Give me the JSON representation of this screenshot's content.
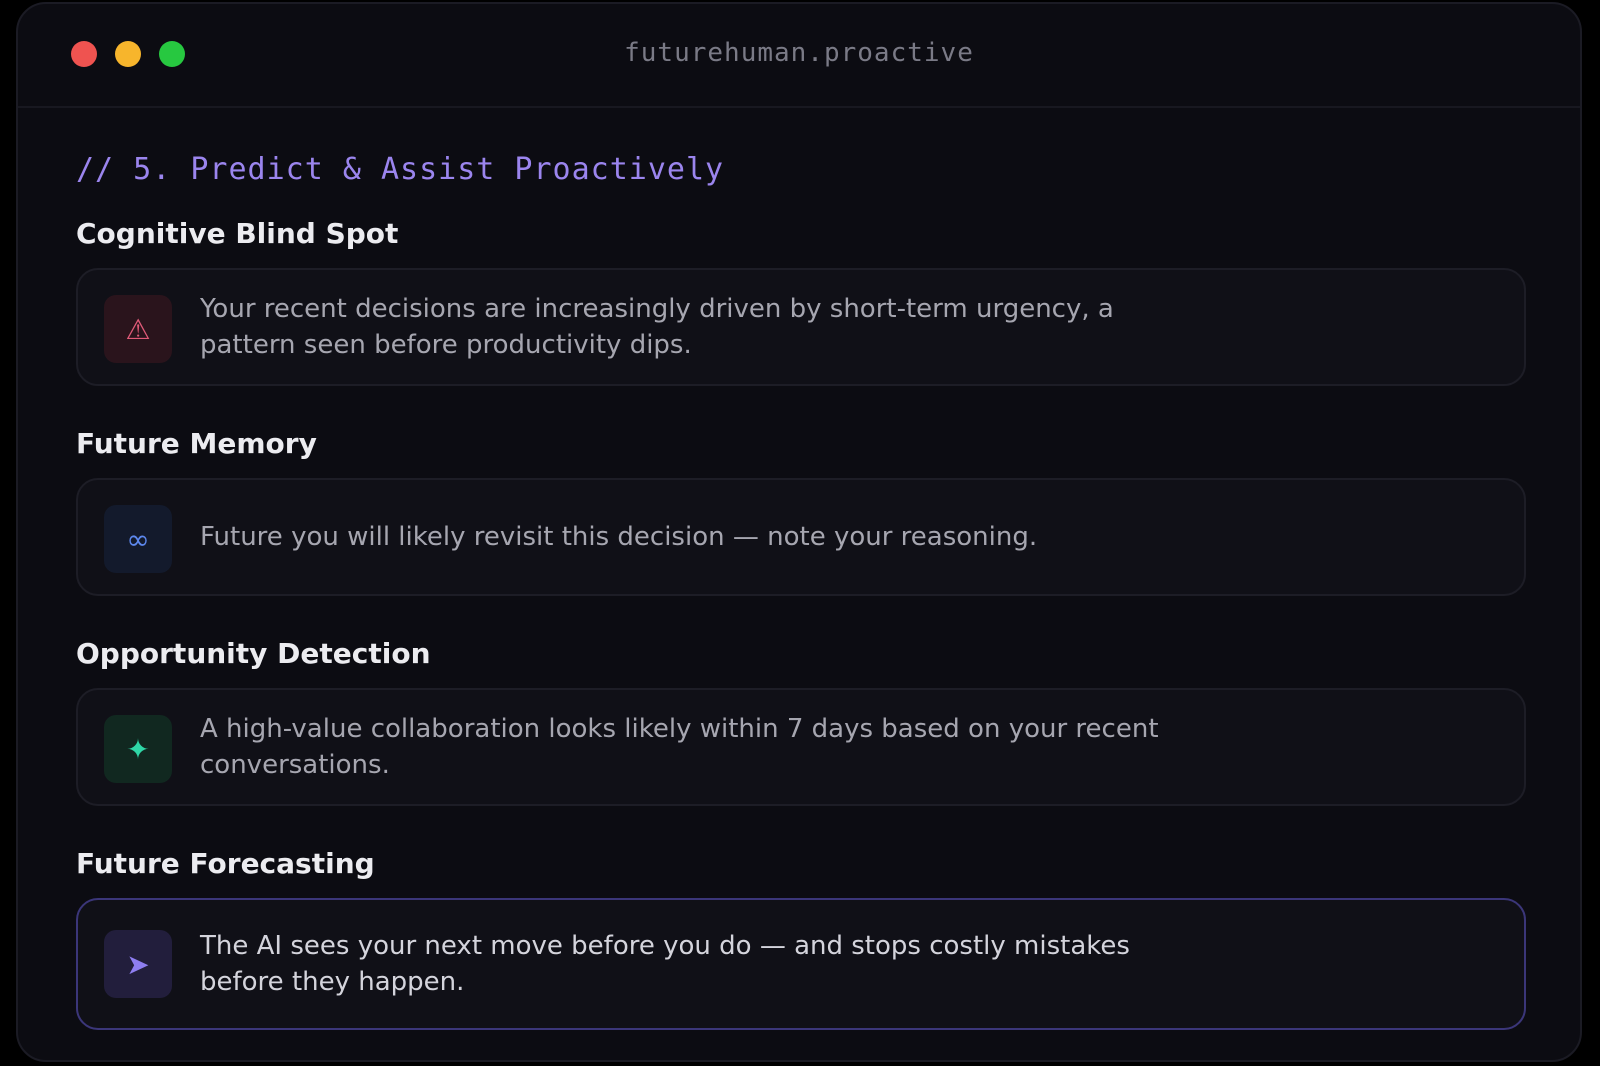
{
  "window": {
    "title": "futurehuman.proactive",
    "controls": {
      "close_color": "#ef5350",
      "minimize_color": "#f7b52c",
      "maximize_color": "#27c840"
    }
  },
  "section": {
    "comment": "// 5. Predict & Assist Proactively"
  },
  "cards": [
    {
      "heading": "Cognitive Blind Spot",
      "icon": "warning-icon",
      "glyph": "⚠",
      "text": "Your recent decisions are increasingly driven by short-term urgency, a pattern seen before productivity dips."
    },
    {
      "heading": "Future Memory",
      "icon": "infinity-icon",
      "glyph": "∞",
      "text": "Future you will likely revisit this decision — note your reasoning."
    },
    {
      "heading": "Opportunity Detection",
      "icon": "sparkle-icon",
      "glyph": "✦",
      "text": "A high-value collaboration looks likely within 7 days based on your recent conversations."
    },
    {
      "heading": "Future Forecasting",
      "icon": "arrow-icon",
      "glyph": "➤",
      "text": "The AI sees your next move before you do — and stops costly mistakes before they happen."
    }
  ],
  "colors": {
    "accent": "#9b85ee",
    "background": "#0c0c12",
    "card_background": "#101017",
    "highlight_border": "#3b3679"
  }
}
